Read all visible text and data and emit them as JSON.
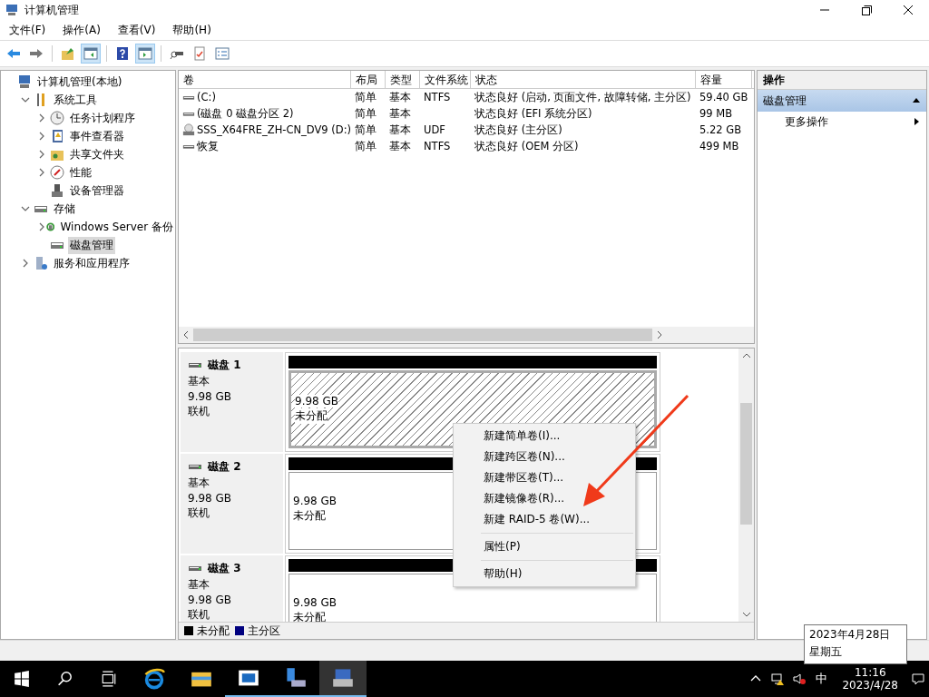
{
  "window": {
    "title": "计算机管理"
  },
  "menu": [
    "文件(F)",
    "操作(A)",
    "查看(V)",
    "帮助(H)"
  ],
  "toolbar": [
    [
      {
        "kind": "back",
        "pressed": false
      },
      {
        "kind": "forward",
        "pressed": false
      }
    ],
    [
      {
        "kind": "up",
        "pressed": false
      },
      {
        "kind": "pane_left",
        "pressed": true
      }
    ],
    [
      {
        "kind": "help",
        "pressed": false
      },
      {
        "kind": "pane_right",
        "pressed": true
      }
    ],
    [
      {
        "kind": "connect",
        "pressed": false
      },
      {
        "kind": "check",
        "pressed": false
      },
      {
        "kind": "list",
        "pressed": false
      }
    ]
  ],
  "tree": [
    {
      "label": "计算机管理(本地)",
      "kind": "computer",
      "selected": false,
      "children": [
        {
          "label": "系统工具",
          "kind": "tools",
          "selected": false,
          "expanded": true,
          "children": [
            {
              "label": "任务计划程序",
              "kind": "clock",
              "selected": false,
              "expanded": false
            },
            {
              "label": "事件查看器",
              "kind": "log",
              "selected": false,
              "expanded": false
            },
            {
              "label": "共享文件夹",
              "kind": "share",
              "selected": false,
              "expanded": false
            },
            {
              "label": "性能",
              "kind": "gauge",
              "selected": false,
              "expanded": false
            },
            {
              "label": "设备管理器",
              "kind": "device",
              "selected": false
            }
          ]
        },
        {
          "label": "存储",
          "kind": "storage",
          "selected": false,
          "expanded": true,
          "children": [
            {
              "label": "Windows Server 备份",
              "kind": "backup",
              "selected": false,
              "expanded": false
            },
            {
              "label": "磁盘管理",
              "kind": "disk",
              "selected": true
            }
          ]
        },
        {
          "label": "服务和应用程序",
          "kind": "services",
          "selected": false,
          "expanded": false
        }
      ]
    }
  ],
  "table": {
    "columns": [
      "卷",
      "布局",
      "类型",
      "文件系统",
      "状态",
      "容量"
    ],
    "rows": [
      {
        "kind": "drive",
        "cells": [
          " (C:)",
          "简单",
          "基本",
          "NTFS",
          "状态良好 (启动, 页面文件, 故障转储, 主分区)",
          "59.40 GB"
        ]
      },
      {
        "kind": "drive",
        "cells": [
          "(磁盘 0 磁盘分区 2)",
          "简单",
          "基本",
          "",
          "状态良好 (EFI 系统分区)",
          "99 MB"
        ]
      },
      {
        "kind": "disc",
        "cells": [
          "SSS_X64FRE_ZH-CN_DV9 (D:)",
          "简单",
          "基本",
          "UDF",
          "状态良好 (主分区)",
          "5.22 GB"
        ]
      },
      {
        "kind": "drive",
        "cells": [
          "恢复",
          "简单",
          "基本",
          "NTFS",
          "状态良好 (OEM 分区)",
          "499 MB"
        ]
      }
    ]
  },
  "disks": [
    {
      "name": "磁盘 1",
      "type": "基本",
      "size": "9.98 GB",
      "status": "联机",
      "partition": {
        "size": "9.98 GB",
        "label": "未分配",
        "selected": true
      }
    },
    {
      "name": "磁盘 2",
      "type": "基本",
      "size": "9.98 GB",
      "status": "联机",
      "partition": {
        "size": "9.98 GB",
        "label": "未分配",
        "selected": false
      }
    },
    {
      "name": "磁盘 3",
      "type": "基本",
      "size": "9.98 GB",
      "status": "联机",
      "partition": {
        "size": "9.98 GB",
        "label": "未分配",
        "selected": false
      }
    }
  ],
  "legend": [
    {
      "label": "未分配",
      "color": "#000000"
    },
    {
      "label": "主分区",
      "color": "#00007f"
    }
  ],
  "context_menu": [
    [
      "新建简单卷(I)...",
      "新建跨区卷(N)...",
      "新建带区卷(T)...",
      "新建镜像卷(R)...",
      "新建 RAID-5 卷(W)..."
    ],
    [
      "属性(P)"
    ],
    [
      "帮助(H)"
    ]
  ],
  "actions": {
    "title": "操作",
    "section": {
      "label": "磁盘管理",
      "expanded": true
    },
    "items": [
      "更多操作"
    ]
  },
  "tooltip": {
    "lines": [
      "2023年4月28日",
      "星期五"
    ]
  },
  "taskbar": {
    "apps": [
      {
        "kind": "browser",
        "running": false,
        "selected": false
      },
      {
        "kind": "explorer",
        "running": false,
        "selected": false
      },
      {
        "kind": "panel",
        "running": true,
        "selected": false
      },
      {
        "kind": "server",
        "running": true,
        "selected": false
      },
      {
        "kind": "manager",
        "running": true,
        "selected": true
      }
    ],
    "ime": "中",
    "time": "11:16",
    "date": "2023/4/28"
  }
}
